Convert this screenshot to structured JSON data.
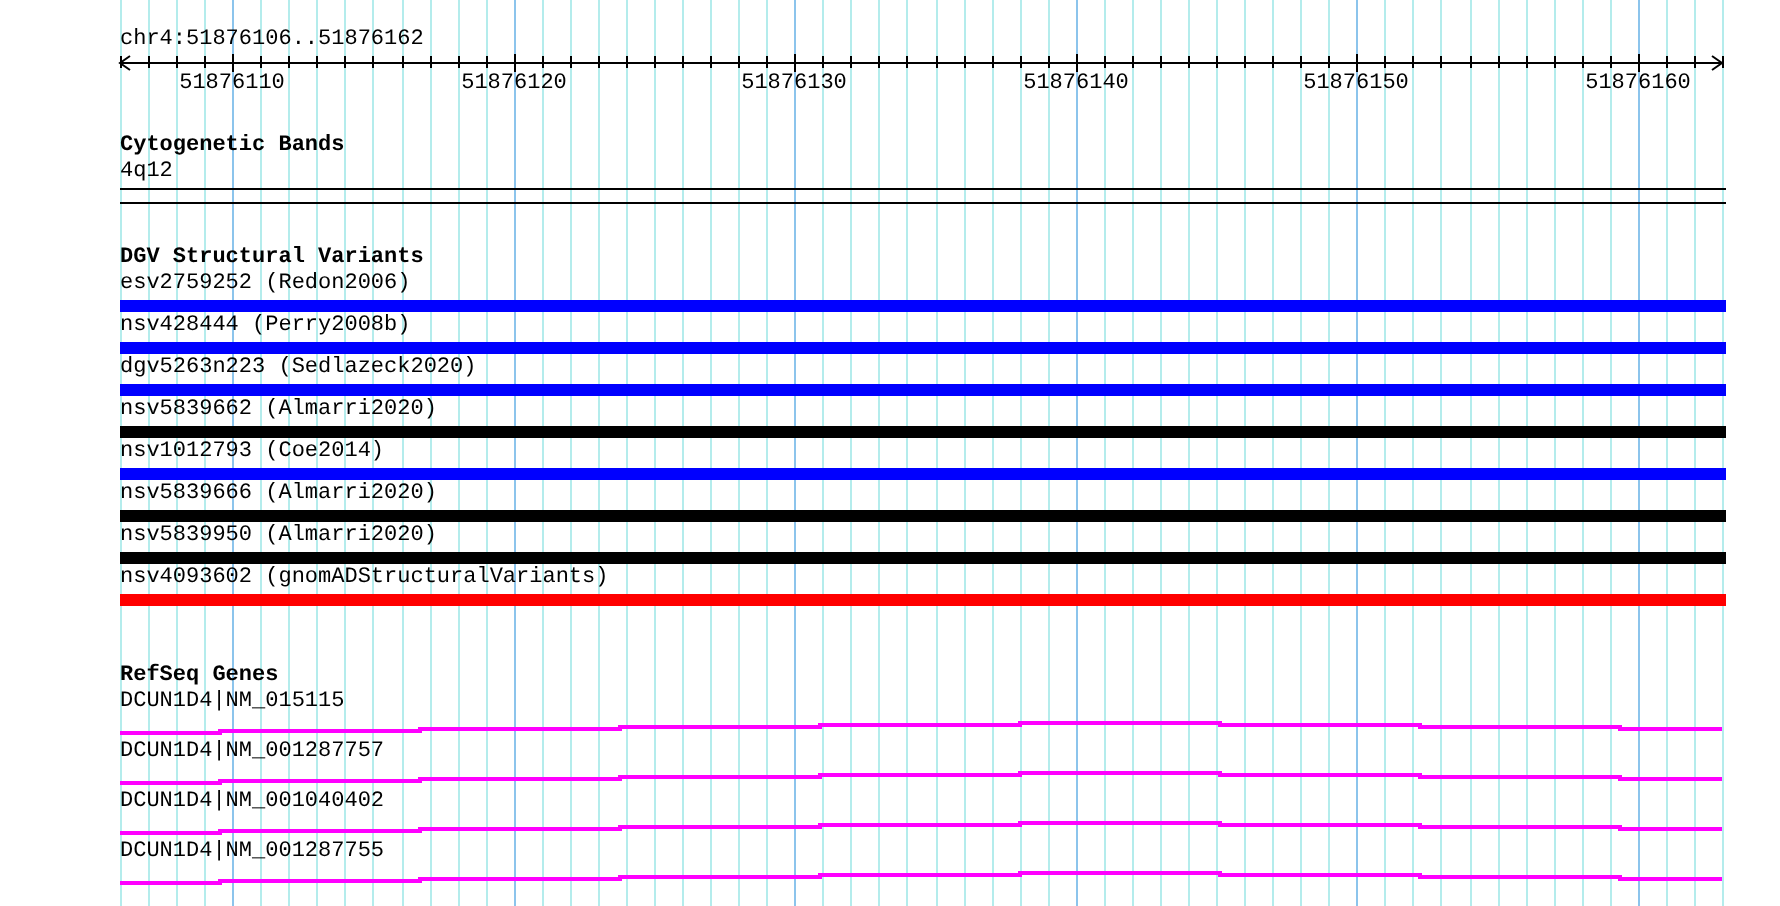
{
  "ruler": {
    "range": "chr4:51876106..51876162",
    "ticks": [
      "51876110",
      "51876120",
      "51876130",
      "51876140",
      "51876150",
      "51876160"
    ]
  },
  "cytogenetic_bands": {
    "title": "Cytogenetic Bands",
    "band": "4q12"
  },
  "dgv_structural_variants": {
    "title": "DGV Structural Variants",
    "variants": [
      {
        "label": "esv2759252 (Redon2006)",
        "color": "#0000ff"
      },
      {
        "label": "nsv428444 (Perry2008b)",
        "color": "#0000ff"
      },
      {
        "label": "dgv5263n223 (Sedlazeck2020)",
        "color": "#0000ff"
      },
      {
        "label": "nsv5839662 (Almarri2020)",
        "color": "#000000"
      },
      {
        "label": "nsv1012793 (Coe2014)",
        "color": "#0000ff"
      },
      {
        "label": "nsv5839666 (Almarri2020)",
        "color": "#000000"
      },
      {
        "label": "nsv5839950 (Almarri2020)",
        "color": "#000000"
      },
      {
        "label": "nsv4093602 (gnomADStructuralVariants)",
        "color": "#ff0000"
      }
    ]
  },
  "refseq_genes": {
    "title": "RefSeq Genes",
    "genes": [
      {
        "label": "DCUN1D4|NM_015115"
      },
      {
        "label": "DCUN1D4|NM_001287757"
      },
      {
        "label": "DCUN1D4|NM_001040402"
      },
      {
        "label": "DCUN1D4|NM_001287755"
      }
    ]
  }
}
